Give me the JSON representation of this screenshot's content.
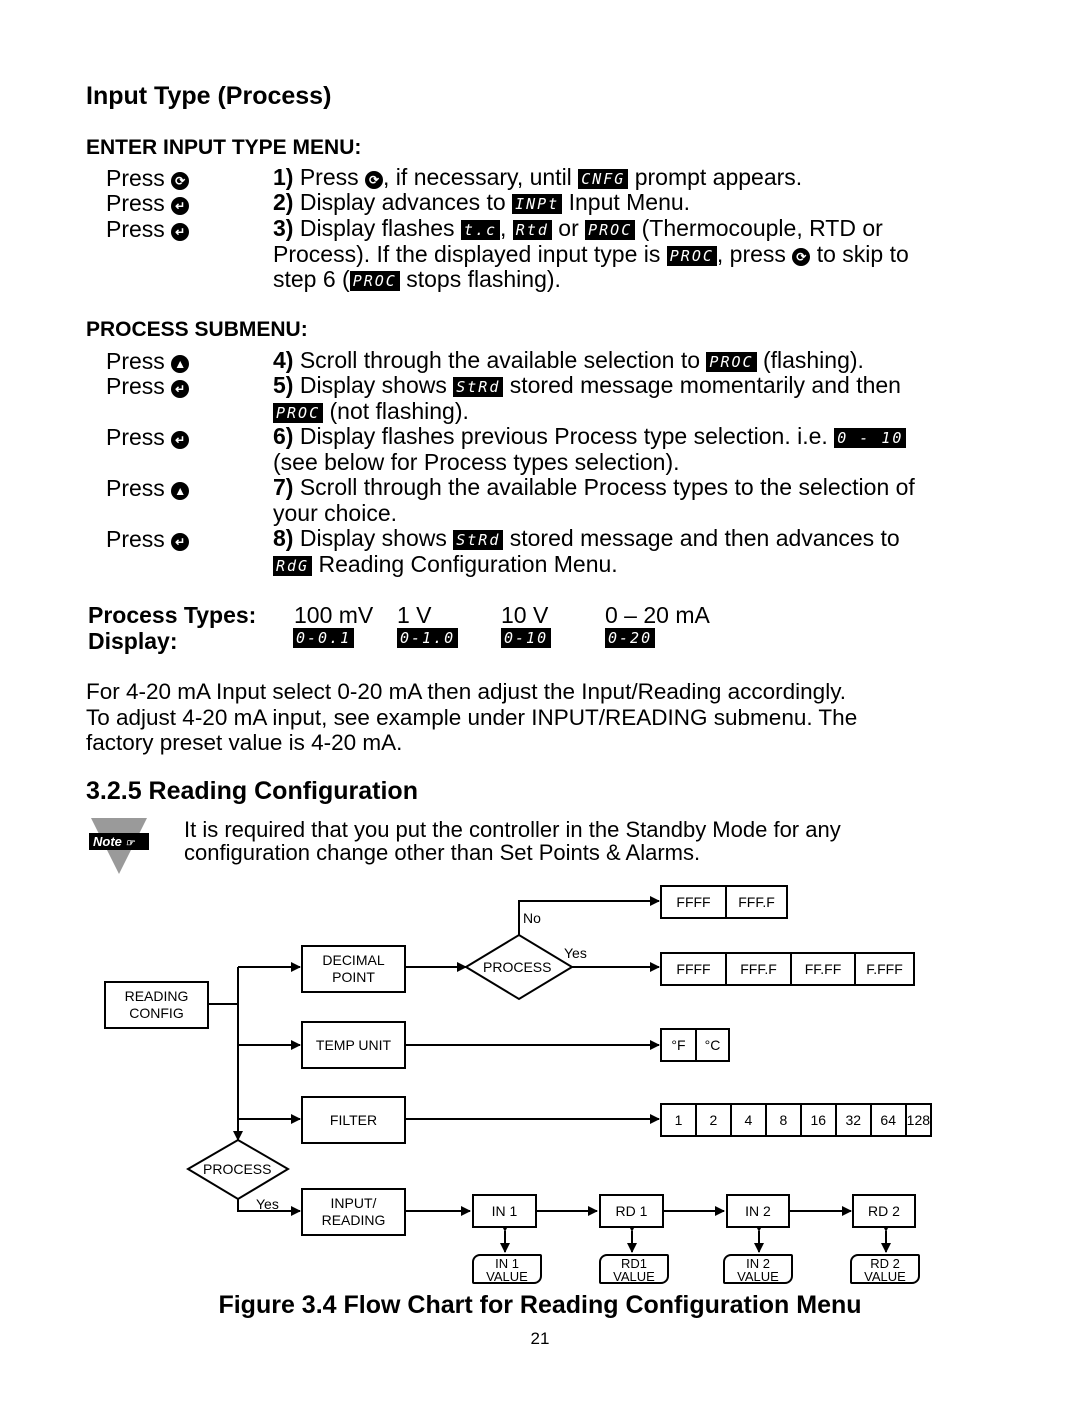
{
  "section_title": "Input Type (Process)",
  "enter_menu": {
    "heading": "ENTER INPUT TYPE MENU:",
    "rows": [
      {
        "press": "Press",
        "icon": "menu-icon",
        "glyph": "⟳",
        "num": "1)",
        "parts": [
          "Press",
          ", if necessary, until",
          "prompt appears."
        ],
        "lcd": [
          "CNFG"
        ]
      },
      {
        "press": "Press",
        "icon": "enter-icon",
        "glyph": "↵",
        "num": "2)",
        "parts": [
          "Display advances to",
          "Input Menu."
        ],
        "lcd": [
          "INPt"
        ]
      },
      {
        "press": "Press",
        "icon": "enter-icon",
        "glyph": "↵",
        "num": "3)",
        "parts": [
          "Display flashes",
          ",",
          "or",
          "(Thermocouple, RTD or",
          "Process). If the displayed input type is",
          ", press",
          "to skip to",
          "step 6 (",
          "stops flashing)."
        ],
        "lcd": [
          "t.c",
          "Rtd",
          "PROC",
          "PROC",
          "PROC"
        ]
      }
    ]
  },
  "process_submenu": {
    "heading": "PROCESS SUBMENU:",
    "rows": [
      {
        "press": "Press",
        "icon": "up-icon",
        "glyph": "▲",
        "num": "4)",
        "text_a": "Scroll through the available selection to",
        "lcd": "PROC",
        "text_b": "(flashing)."
      },
      {
        "press": "Press",
        "icon": "enter-icon",
        "glyph": "↵",
        "num": "5)",
        "text_a": "Display shows",
        "lcd": "StRd",
        "text_b": "stored message momentarily and then",
        "lcd2": "PROC",
        "text_c": "(not flashing)."
      },
      {
        "press": "Press",
        "icon": "enter-icon",
        "glyph": "↵",
        "num": "6)",
        "text_a": "Display flashes previous Process type selection. i.e.",
        "lcd": "0 - 10",
        "text_b": "(see below for Process types selection)."
      },
      {
        "press": "Press",
        "icon": "up-icon",
        "glyph": "▲",
        "num": "7)",
        "text_a": "Scroll through the available Process types to the selection of",
        "text_b": "your choice."
      },
      {
        "press": "Press",
        "icon": "enter-icon",
        "glyph": "↵",
        "num": "8)",
        "text_a": "Display shows",
        "lcd": "StRd",
        "text_b": "stored message and then advances to",
        "lcd2": "RdG",
        "text_c": "Reading Configuration Menu."
      }
    ]
  },
  "process_types": {
    "label_types": "Process Types:",
    "label_display": "Display:",
    "items": [
      {
        "type": "100 mV",
        "display": "0-0.1"
      },
      {
        "type": "1 V",
        "display": "0-1.0"
      },
      {
        "type": "10 V",
        "display": "0-10"
      },
      {
        "type": "0 – 20 mA",
        "display": "0-20"
      }
    ]
  },
  "note_paragraph": [
    "For 4-20 mA Input select 0-20 mA then adjust the Input/Reading accordingly.",
    "To adjust 4-20 mA input, see example under INPUT/READING submenu. The",
    "factory preset value is 4-20 mA."
  ],
  "reading_config": {
    "heading": "3.2.5 Reading Configuration",
    "note_badge": "Note",
    "note_lines": [
      "It is required that you put the controller in the Standby Mode for any",
      "configuration change other than Set Points & Alarms."
    ]
  },
  "flowchart": {
    "start": "READING CONFIG",
    "decimal_point": "DECIMAL POINT",
    "temp_unit": "TEMP UNIT",
    "filter": "FILTER",
    "input_reading": "INPUT/ READING",
    "process_decision": "PROCESS",
    "process_decision2": "PROCESS",
    "no_label": "No",
    "yes_label": "Yes",
    "yes_label2": "Yes",
    "formats_no": [
      "FFFF",
      "FFF.F"
    ],
    "formats_yes": [
      "FFFF",
      "FFF.F",
      "FF.FF",
      "F.FFF"
    ],
    "temp_units": [
      "°F",
      "°C"
    ],
    "filter_values": [
      "1",
      "2",
      "4",
      "8",
      "16",
      "32",
      "64",
      "128"
    ],
    "chain": [
      {
        "box": "IN 1",
        "value": [
          "IN 1",
          "VALUE"
        ]
      },
      {
        "box": "RD 1",
        "value": [
          "RD1",
          "VALUE"
        ]
      },
      {
        "box": "IN 2",
        "value": [
          "IN 2",
          "VALUE"
        ]
      },
      {
        "box": "RD 2",
        "value": [
          "RD 2",
          "VALUE"
        ]
      }
    ]
  },
  "figure_caption": "Figure 3.4 Flow Chart for Reading Configuration Menu",
  "page_number": "21"
}
